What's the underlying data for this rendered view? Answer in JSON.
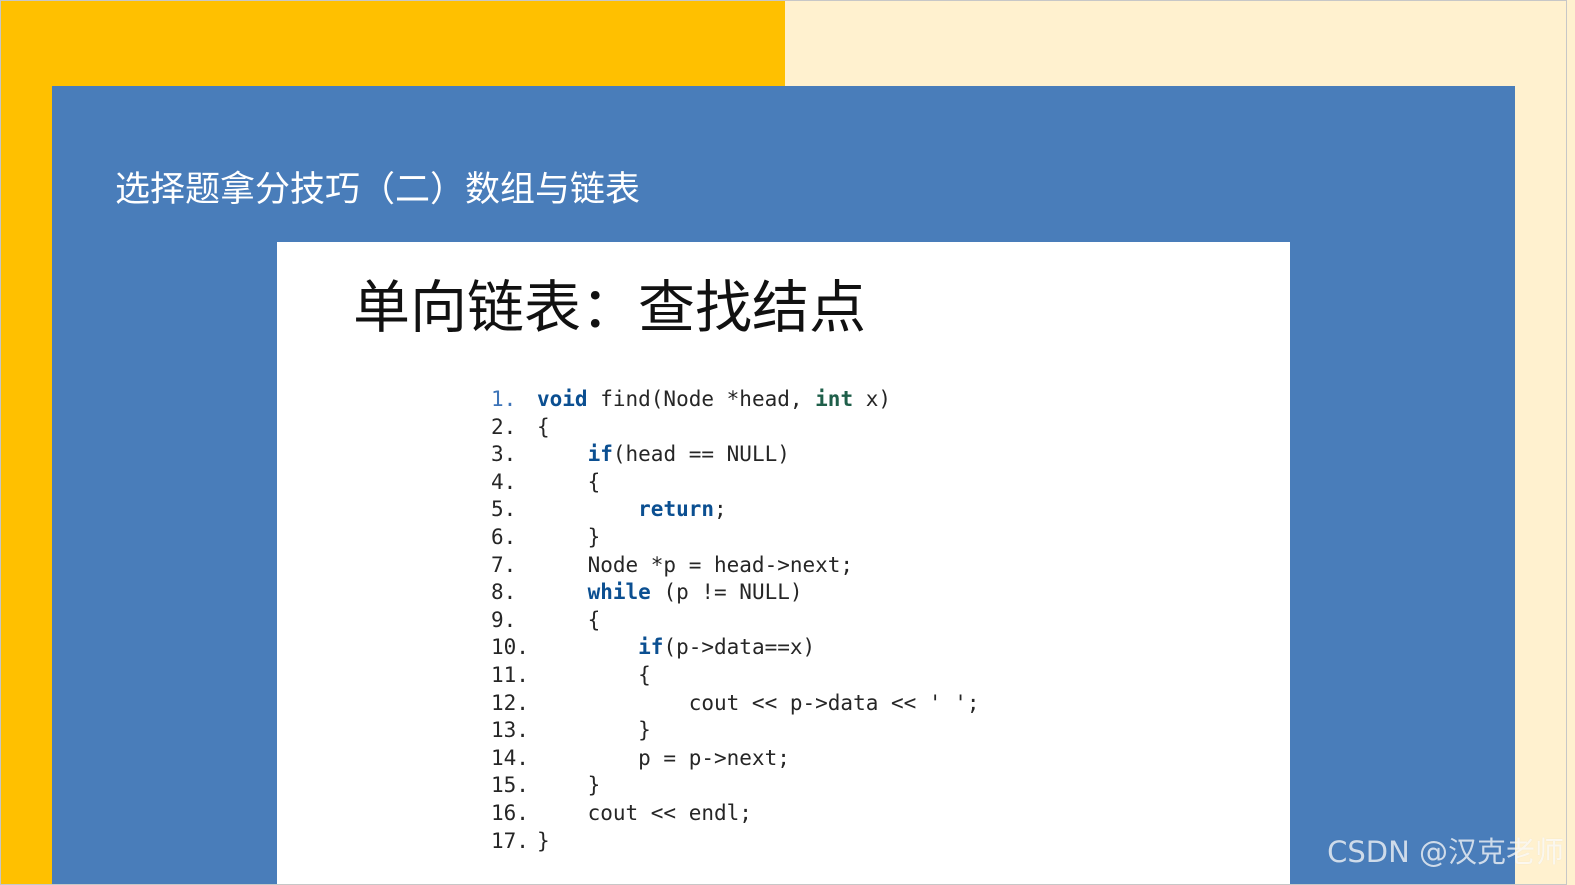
{
  "slide": {
    "title": "选择题拿分技巧（二）数组与链表",
    "card_heading": "单向链表：查找结点",
    "watermark": "CSDN @汉克老师",
    "colors": {
      "left_background": "#ffc000",
      "right_background": "#fff1cf",
      "blue_panel": "#497dba",
      "card_background": "#ffffff",
      "code_keyword_blue": "#0b4f91",
      "code_keyword_green": "#1f5f4a",
      "line_number_first": "#3d74b8"
    }
  },
  "code": {
    "lines": [
      {
        "number": "1.",
        "segments": [
          {
            "text": "void",
            "style": "kw-blue"
          },
          {
            "text": " find(Node *head, ",
            "style": "plain"
          },
          {
            "text": "int",
            "style": "kw-green"
          },
          {
            "text": " x)",
            "style": "plain"
          }
        ]
      },
      {
        "number": "2.",
        "segments": [
          {
            "text": "{",
            "style": "plain"
          }
        ]
      },
      {
        "number": "3.",
        "segments": [
          {
            "text": "    ",
            "style": "plain"
          },
          {
            "text": "if",
            "style": "kw-blue"
          },
          {
            "text": "(head == NULL)",
            "style": "plain"
          }
        ]
      },
      {
        "number": "4.",
        "segments": [
          {
            "text": "    {",
            "style": "plain"
          }
        ]
      },
      {
        "number": "5.",
        "segments": [
          {
            "text": "        ",
            "style": "plain"
          },
          {
            "text": "return",
            "style": "kw-blue"
          },
          {
            "text": ";",
            "style": "plain"
          }
        ]
      },
      {
        "number": "6.",
        "segments": [
          {
            "text": "    }",
            "style": "plain"
          }
        ]
      },
      {
        "number": "7.",
        "segments": [
          {
            "text": "    Node *p = head->next;",
            "style": "plain"
          }
        ]
      },
      {
        "number": "8.",
        "segments": [
          {
            "text": "    ",
            "style": "plain"
          },
          {
            "text": "while",
            "style": "kw-blue"
          },
          {
            "text": " (p != NULL)",
            "style": "plain"
          }
        ]
      },
      {
        "number": "9.",
        "segments": [
          {
            "text": "    {",
            "style": "plain"
          }
        ]
      },
      {
        "number": "10.",
        "segments": [
          {
            "text": "        ",
            "style": "plain"
          },
          {
            "text": "if",
            "style": "kw-blue"
          },
          {
            "text": "(p->data==x)",
            "style": "plain"
          }
        ]
      },
      {
        "number": "11.",
        "segments": [
          {
            "text": "        {",
            "style": "plain"
          }
        ]
      },
      {
        "number": "12.",
        "segments": [
          {
            "text": "            cout << p->data << ' ';",
            "style": "plain"
          }
        ]
      },
      {
        "number": "13.",
        "segments": [
          {
            "text": "        }",
            "style": "plain"
          }
        ]
      },
      {
        "number": "14.",
        "segments": [
          {
            "text": "        p = p->next;",
            "style": "plain"
          }
        ]
      },
      {
        "number": "15.",
        "segments": [
          {
            "text": "    }",
            "style": "plain"
          }
        ]
      },
      {
        "number": "16.",
        "segments": [
          {
            "text": "    cout << endl;",
            "style": "plain"
          }
        ]
      },
      {
        "number": "17.",
        "segments": [
          {
            "text": "}",
            "style": "plain"
          }
        ]
      }
    ]
  }
}
